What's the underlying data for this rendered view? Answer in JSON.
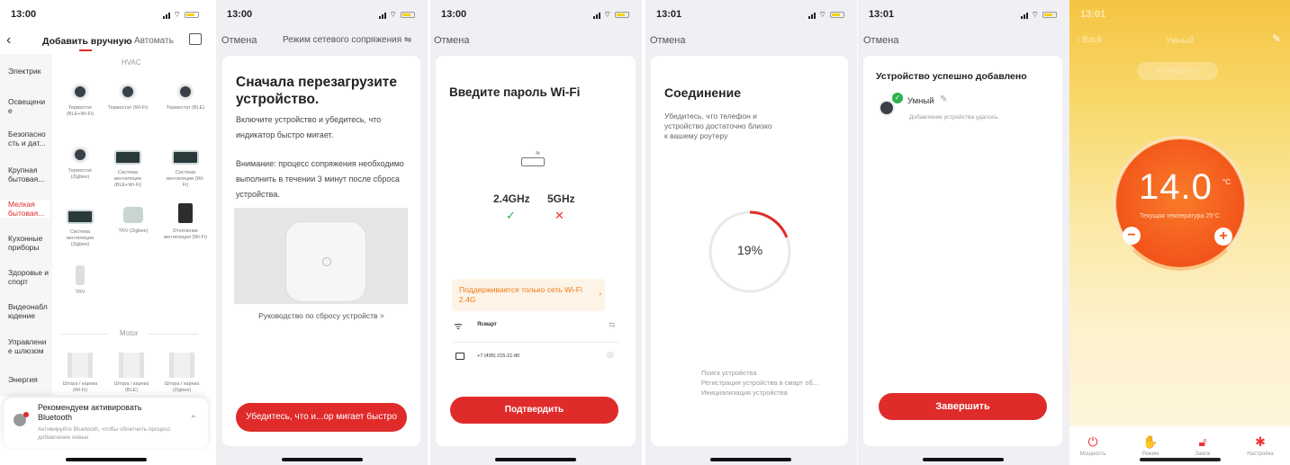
{
  "status_times": [
    "13:00",
    "13:00",
    "13:00",
    "13:01",
    "13:01",
    "13:01"
  ],
  "screen1": {
    "tab_active": "Добавить вручную",
    "tab_other": "Автомать",
    "section_hvac": "HVAC",
    "section_motor": "Motor",
    "sidebar": [
      "Электрик",
      "Освещени е",
      "Безопасно сть и дат...",
      "Крупная бытовая...",
      "Мелкая бытовая...",
      "Кухонные приборы",
      "Здоровье и спорт",
      "Видеонабл юдение",
      "Управлени е шлюзом",
      "Энергия"
    ],
    "sidebar_active_index": 4,
    "hvac_items": [
      "Термостат (BLE+Wi-Fi)",
      "Термостат (Wi-Fi)",
      "Термостат (BLE)",
      "Термостат (Zigbee)",
      "Система вентиляции (BLE+Wi-Fi)",
      "Система вентиляции (Wi-Fi)",
      "Система вентиляции (Zigbee)",
      "TRV (Zigbee)",
      "Отопление вентиляция (Wi-Fi)",
      "TRV"
    ],
    "motor_items": [
      "Штора / карниз (Wi-Fi)",
      "Штора / карниз (BLE)",
      "Штора / карниз (Zigbee)"
    ],
    "bt_title": "Рекомендуем активировать Bluetooth",
    "bt_desc": "Активируйте Bluetooth, чтобы облегчить процесс добавление новых"
  },
  "screen2": {
    "cancel": "Отмена",
    "mode": "Режим сетевого сопряжения ⇋",
    "title": "Сначала перезагрузите устройство.",
    "desc": "Включите устройство и убедитесь, что индикатор быстро мигает.",
    "note": "Внимание: процесс сопряжения необходимо выполнить в течении 3 минут после сброса устройства.",
    "guide_link": "Руководство по сбросу устройств >",
    "button": "Убедитесь, что и...ор мигает быстро"
  },
  "screen3": {
    "cancel": "Отмена",
    "title": "Введите пароль Wi-Fi",
    "band_24": "2.4GHz",
    "band_5": "5GHz",
    "warning": "Поддерживается только сеть Wi-Fi 2.4G",
    "ssid": "Ясмарт",
    "password": "+7 (495) 215-21-80",
    "button": "Подтвердить"
  },
  "screen4": {
    "cancel": "Отмена",
    "title": "Соединение",
    "desc": "Убедитесь, что телефон и устройство достаточно близко к вашему роутеру",
    "progress_percent": 19,
    "steps": [
      "Поиск устройства",
      "Регистрация устройства в смарт об...",
      "Инициализация устройства"
    ]
  },
  "screen5": {
    "cancel": "Отмена",
    "title": "Устройство успешно добавлено",
    "device_name": "Умный",
    "device_status": "Добавление устройства удалось.",
    "button": "Завершить"
  },
  "screen6": {
    "back": "Back",
    "title": "Умный",
    "guide_button": "Руководство",
    "temperature": "14.0",
    "unit": "°C",
    "current": "Текущая температура 25°C",
    "controls": [
      "Мощность",
      "Режим",
      "Замок",
      "Настройка"
    ]
  },
  "colors": {
    "accent": "#e02b2b",
    "orange_top": "#f7c948",
    "orange_dial": "#f25a1a",
    "check_green": "#2bb24c"
  }
}
